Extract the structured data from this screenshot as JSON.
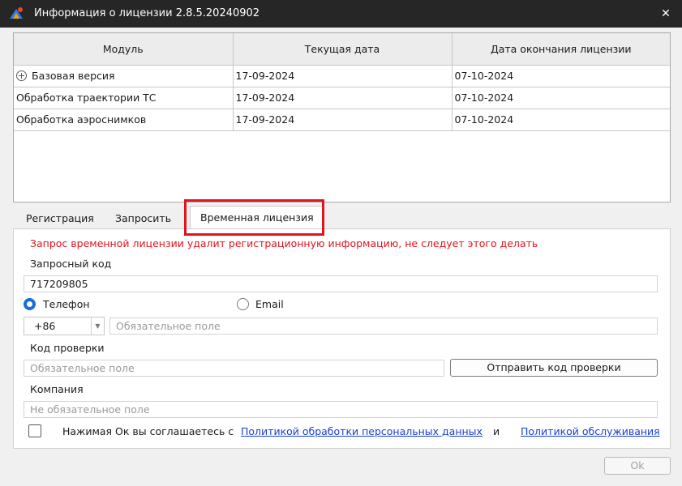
{
  "window": {
    "title": "Информация о лицензии 2.8.5.20240902",
    "close_glyph": "✕",
    "accent": "#1b6fd1"
  },
  "license_table": {
    "columns": [
      "Модуль",
      "Текущая дата",
      "Дата окончания лицензии"
    ],
    "rows": [
      {
        "module": "Базовая версия",
        "current": "17-09-2024",
        "expires": "07-10-2024"
      },
      {
        "module": "Обработка траектории ТС",
        "current": "17-09-2024",
        "expires": "07-10-2024"
      },
      {
        "module": "Обработка аэроснимков",
        "current": "17-09-2024",
        "expires": "07-10-2024"
      }
    ]
  },
  "tabs": [
    {
      "label": "Регистрация"
    },
    {
      "label": "Запросить"
    },
    {
      "label": "Временная лицензия",
      "active": true
    }
  ],
  "form": {
    "warning": "Запрос временной лицензии удалит регистрационную информацию, не следует этого делать",
    "request_code_label": "Запросный код",
    "request_code_value": "717209805",
    "phone_label": "Телефон",
    "email_label": "Email",
    "country_code": "+86",
    "phone_placeholder": "Обязательное поле",
    "verification_label": "Код проверки",
    "verification_placeholder": "Обязательное поле",
    "send_code_button": "Отправить код проверки",
    "company_label": "Компания",
    "company_placeholder": "Не обязательное поле",
    "agree_text": "Нажимая Ок вы соглашаетесь с",
    "privacy_link": "Политикой обработки персональных данных",
    "and_text": "и",
    "service_link": "Политикой обслуживания"
  },
  "footer": {
    "ok_label": "Ok"
  }
}
